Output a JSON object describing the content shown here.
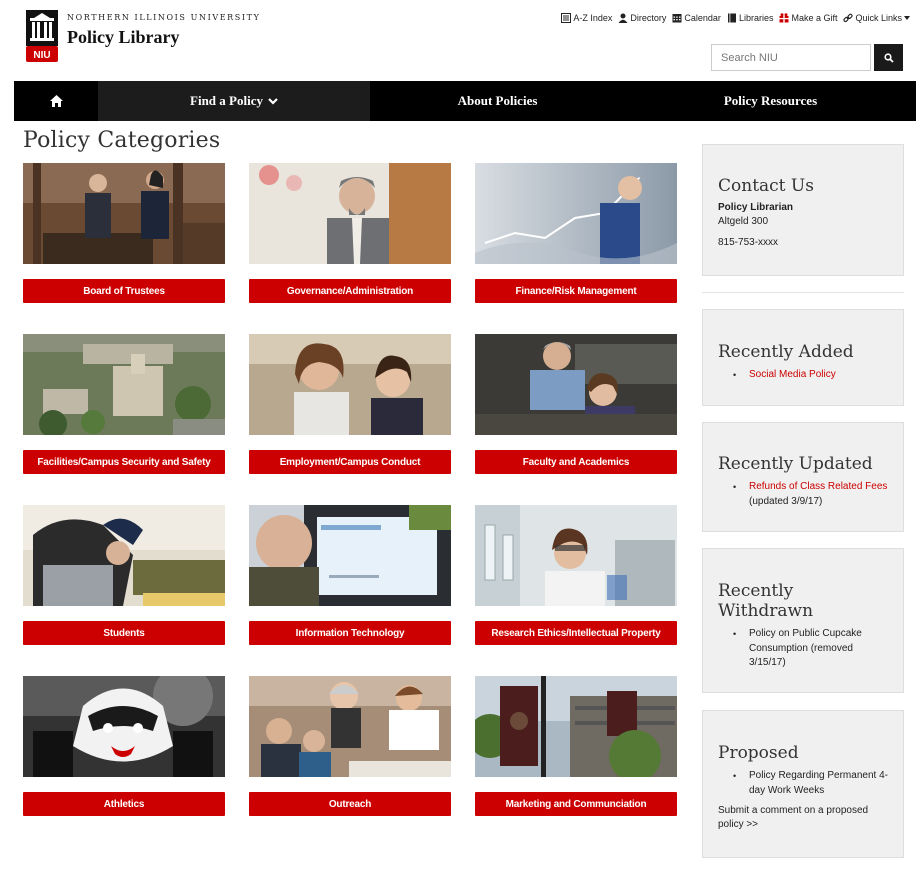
{
  "header": {
    "university": "NORTHERN ILLINOIS UNIVERSITY",
    "site_title": "Policy Library",
    "logo_text": "NIU",
    "utility_links": [
      {
        "label": "A-Z Index",
        "icon": "list-icon"
      },
      {
        "label": "Directory",
        "icon": "person-icon"
      },
      {
        "label": "Calendar",
        "icon": "calendar-icon"
      },
      {
        "label": "Libraries",
        "icon": "book-icon"
      },
      {
        "label": "Make a Gift",
        "icon": "gift-icon"
      },
      {
        "label": "Quick Links",
        "icon": "link-icon"
      }
    ],
    "search_placeholder": "Search NIU"
  },
  "nav": {
    "items": [
      {
        "label": "Find a Policy"
      },
      {
        "label": "About Policies"
      },
      {
        "label": "Policy Resources"
      }
    ]
  },
  "main": {
    "title": "Policy Categories",
    "categories": [
      {
        "label": "Board of Trustees"
      },
      {
        "label": "Governance/Administration"
      },
      {
        "label": "Finance/Risk Management"
      },
      {
        "label": "Facilities/Campus Security and Safety"
      },
      {
        "label": "Employment/Campus Conduct"
      },
      {
        "label": "Faculty and Academics"
      },
      {
        "label": "Students"
      },
      {
        "label": "Information Technology"
      },
      {
        "label": "Research Ethics/Intellectual Property"
      },
      {
        "label": "Athletics"
      },
      {
        "label": "Outreach"
      },
      {
        "label": "Marketing and Communciation"
      }
    ]
  },
  "sidebar": {
    "contact": {
      "title": "Contact Us",
      "name": "Policy Librarian",
      "location": "Altgeld 300",
      "phone": "815-753-xxxx"
    },
    "recently_added": {
      "title": "Recently Added",
      "items": [
        {
          "link": "Social Media Policy"
        }
      ]
    },
    "recently_updated": {
      "title": "Recently Updated",
      "items": [
        {
          "link": "Refunds of Class Related Fees",
          "note": " (updated 3/9/17)"
        }
      ]
    },
    "recently_withdrawn": {
      "title_line1": "Recently",
      "title_line2": "Withdrawn",
      "items": [
        {
          "text": "Policy on Public Cupcake Consumption (removed 3/15/17)"
        }
      ]
    },
    "proposed": {
      "title": "Proposed",
      "items": [
        {
          "text": "Policy Regarding Permanent 4-day Work Weeks"
        }
      ],
      "comment_link": "Submit a comment on a proposed policy >>"
    }
  },
  "colors": {
    "accent": "#cc0000",
    "nav_bg": "#000000",
    "sidebar_bg": "#f0f0f0"
  }
}
